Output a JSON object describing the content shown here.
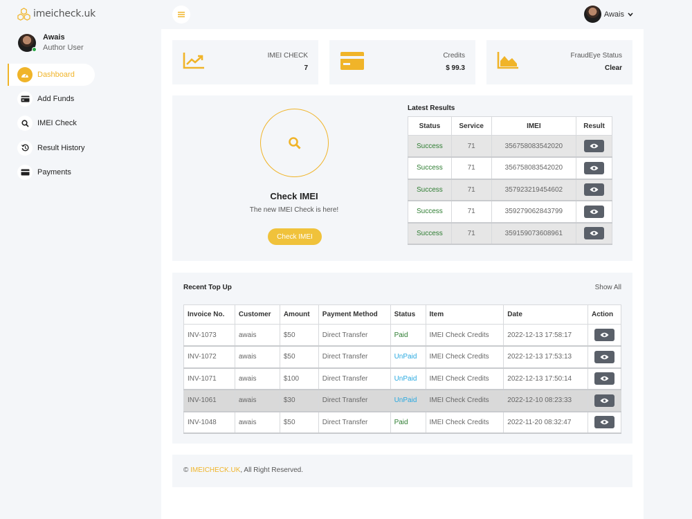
{
  "brand": {
    "name": "imeicheck.uk"
  },
  "user": {
    "name": "Awais",
    "role": "Author User"
  },
  "nav": [
    {
      "label": "Dashboard",
      "icon": "gauge-icon",
      "active": true
    },
    {
      "label": "Add Funds",
      "icon": "credit-card-icon",
      "active": false
    },
    {
      "label": "IMEI Check",
      "icon": "search-icon",
      "active": false
    },
    {
      "label": "Result History",
      "icon": "history-icon",
      "active": false
    },
    {
      "label": "Payments",
      "icon": "wallet-icon",
      "active": false
    }
  ],
  "topbar": {
    "user_name": "Awais"
  },
  "stats": [
    {
      "label": "IMEI CHECK",
      "value": "7",
      "icon": "chart-line-icon"
    },
    {
      "label": "Credits",
      "value": "$ 99.3",
      "icon": "credit-card-icon"
    },
    {
      "label": "FraudEye Status",
      "value": "Clear",
      "icon": "area-chart-icon"
    }
  ],
  "check": {
    "title": "Check IMEI",
    "subtitle": "The new IMEI Check is here!",
    "button": "Check IMEI"
  },
  "latest_results": {
    "title": "Latest Results",
    "columns": [
      "Status",
      "Service",
      "IMEI",
      "Result"
    ],
    "rows": [
      {
        "status": "Success",
        "service": "71",
        "imei": "356758083542020"
      },
      {
        "status": "Success",
        "service": "71",
        "imei": "356758083542020"
      },
      {
        "status": "Success",
        "service": "71",
        "imei": "357923219454602"
      },
      {
        "status": "Success",
        "service": "71",
        "imei": "359279062843799"
      },
      {
        "status": "Success",
        "service": "71",
        "imei": "359159073608961"
      }
    ]
  },
  "recent_topup": {
    "title": "Recent Top Up",
    "show_all": "Show All",
    "columns": [
      "Invoice No.",
      "Customer",
      "Amount",
      "Payment Method",
      "Status",
      "Item",
      "Date",
      "Action"
    ],
    "rows": [
      {
        "invoice": "INV-1073",
        "customer": "awais",
        "amount": "$50",
        "method": "Direct Transfer",
        "status": "Paid",
        "item": "IMEI Check Credits",
        "date": "2022-12-13 17:58:17"
      },
      {
        "invoice": "INV-1072",
        "customer": "awais",
        "amount": "$50",
        "method": "Direct Transfer",
        "status": "UnPaid",
        "item": "IMEI Check Credits",
        "date": "2022-12-13 17:53:13"
      },
      {
        "invoice": "INV-1071",
        "customer": "awais",
        "amount": "$100",
        "method": "Direct Transfer",
        "status": "UnPaid",
        "item": "IMEI Check Credits",
        "date": "2022-12-13 17:50:14"
      },
      {
        "invoice": "INV-1061",
        "customer": "awais",
        "amount": "$30",
        "method": "Direct Transfer",
        "status": "UnPaid",
        "item": "IMEI Check Credits",
        "date": "2022-12-10 08:23:33"
      },
      {
        "invoice": "INV-1048",
        "customer": "awais",
        "amount": "$50",
        "method": "Direct Transfer",
        "status": "Paid",
        "item": "IMEI Check Credits",
        "date": "2022-11-20 08:32:47"
      }
    ]
  },
  "footer": {
    "prefix": "© ",
    "brand": "IMEICHECK.UK",
    "suffix": ", All Right Reserved."
  },
  "colors": {
    "accent": "#f0b429",
    "paid": "#2e7d32",
    "unpaid": "#29a9e0",
    "button_dark": "#5a6069"
  }
}
